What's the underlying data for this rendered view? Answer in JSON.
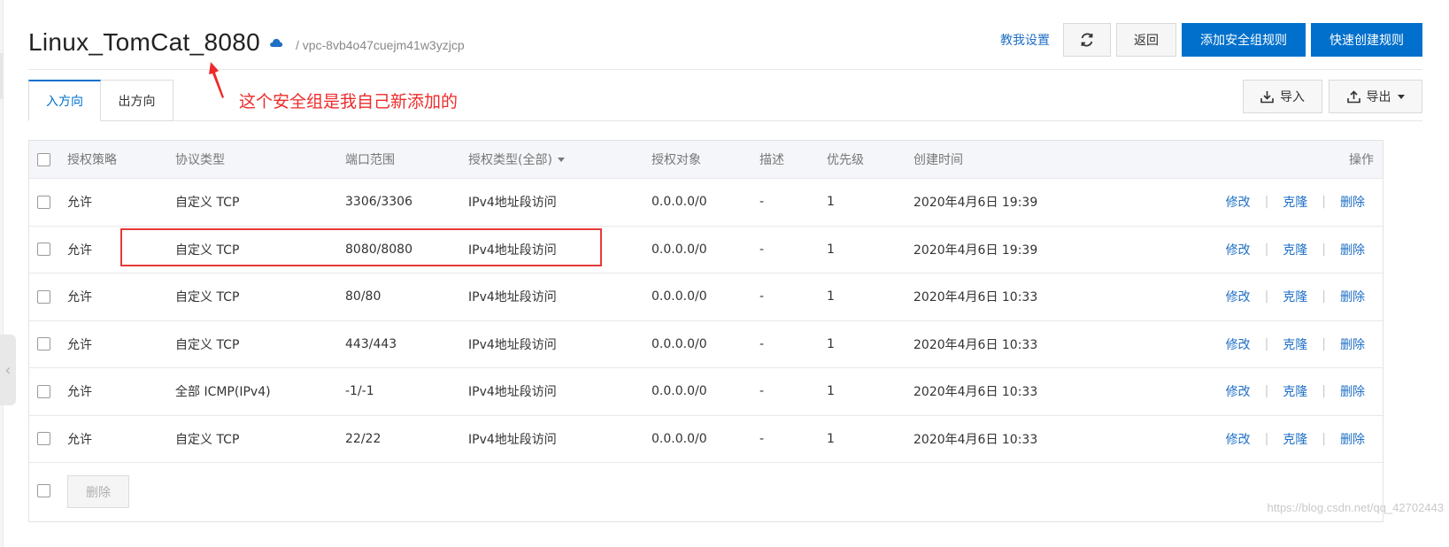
{
  "header": {
    "title": "Linux_TomCat_8080",
    "vpc": "/ vpc-8vb4o47cuejm41w3yzjcp",
    "help_link": "教我设置",
    "back_label": "返回",
    "add_rule_label": "添加安全组规则",
    "quick_rule_label": "快速创建规则"
  },
  "tabs": [
    {
      "label": "入方向",
      "active": true
    },
    {
      "label": "出方向",
      "active": false
    }
  ],
  "tools": {
    "import_label": "导入",
    "export_label": "导出"
  },
  "annotation": {
    "text": "这个安全组是我自己新添加的"
  },
  "table": {
    "columns": {
      "policy": "授权策略",
      "protocol": "协议类型",
      "port": "端口范围",
      "auth_type": "授权类型(全部)",
      "target": "授权对象",
      "desc": "描述",
      "priority": "优先级",
      "created": "创建时间",
      "ops": "操作"
    },
    "rows": [
      {
        "policy": "允许",
        "protocol": "自定义 TCP",
        "port": "3306/3306",
        "auth_type": "IPv4地址段访问",
        "target": "0.0.0.0/0",
        "desc": "-",
        "priority": "1",
        "created": "2020年4月6日 19:39"
      },
      {
        "policy": "允许",
        "protocol": "自定义 TCP",
        "port": "8080/8080",
        "auth_type": "IPv4地址段访问",
        "target": "0.0.0.0/0",
        "desc": "-",
        "priority": "1",
        "created": "2020年4月6日 19:39"
      },
      {
        "policy": "允许",
        "protocol": "自定义 TCP",
        "port": "80/80",
        "auth_type": "IPv4地址段访问",
        "target": "0.0.0.0/0",
        "desc": "-",
        "priority": "1",
        "created": "2020年4月6日 10:33"
      },
      {
        "policy": "允许",
        "protocol": "自定义 TCP",
        "port": "443/443",
        "auth_type": "IPv4地址段访问",
        "target": "0.0.0.0/0",
        "desc": "-",
        "priority": "1",
        "created": "2020年4月6日 10:33"
      },
      {
        "policy": "允许",
        "protocol": "全部 ICMP(IPv4)",
        "port": "-1/-1",
        "auth_type": "IPv4地址段访问",
        "target": "0.0.0.0/0",
        "desc": "-",
        "priority": "1",
        "created": "2020年4月6日 10:33"
      },
      {
        "policy": "允许",
        "protocol": "自定义 TCP",
        "port": "22/22",
        "auth_type": "IPv4地址段访问",
        "target": "0.0.0.0/0",
        "desc": "-",
        "priority": "1",
        "created": "2020年4月6日 10:33"
      }
    ],
    "ops": {
      "edit": "修改",
      "clone": "克隆",
      "delete": "删除"
    }
  },
  "footer": {
    "delete_label": "删除"
  },
  "watermark": "https://blog.csdn.net/qq_42702443",
  "colors": {
    "primary": "#0070cc",
    "link": "#1f6fc5",
    "annotation": "#ee2b2b"
  }
}
